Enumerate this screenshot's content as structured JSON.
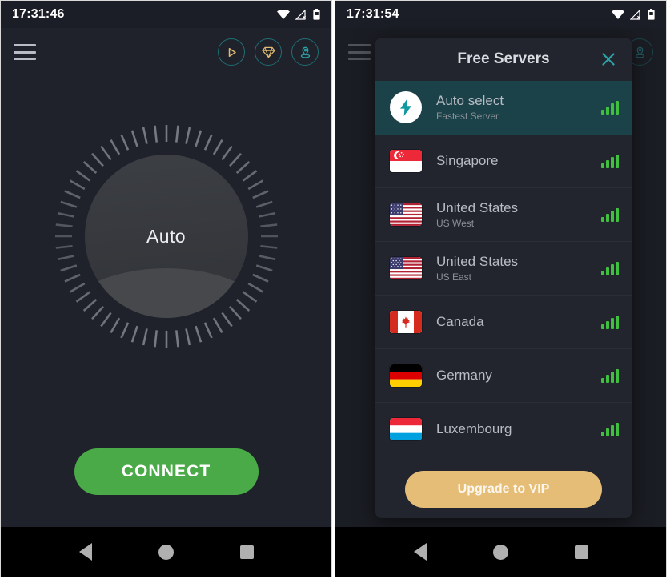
{
  "left_screen": {
    "status_bar": {
      "time": "17:31:46",
      "icons": [
        "wifi-icon",
        "cellular-off-icon",
        "battery-icon"
      ]
    },
    "app_bar": {
      "menu_icon": "hamburger-menu-icon",
      "actions": [
        {
          "name": "play-button",
          "icon": "play-icon",
          "color": "#e0b972"
        },
        {
          "name": "vip-diamond-button",
          "icon": "diamond-icon",
          "color": "#e0b972"
        },
        {
          "name": "location-button",
          "icon": "location-pin-icon",
          "color": "#2aa3a8"
        }
      ]
    },
    "dial": {
      "label": "Auto",
      "tick_count": 60
    },
    "connect_button": {
      "label": "CONNECT",
      "color": "#4aaa47"
    },
    "nav_bar": {
      "back": "back-triangle-icon",
      "home": "home-circle-icon",
      "recents": "recents-square-icon"
    }
  },
  "right_screen": {
    "status_bar": {
      "time": "17:31:54",
      "icons": [
        "wifi-icon",
        "cellular-off-icon",
        "battery-icon"
      ]
    },
    "dialog": {
      "title": "Free Servers",
      "close_icon": "close-x-icon",
      "close_color": "#2aa3a8",
      "servers": [
        {
          "name": "Auto select",
          "subtitle": "Fastest Server",
          "icon": "lightning-bolt-icon",
          "flag": "auto",
          "signal": 4,
          "selected": true
        },
        {
          "name": "Singapore",
          "subtitle": "",
          "flag": "singapore",
          "signal": 4,
          "selected": false
        },
        {
          "name": "United States",
          "subtitle": "US West",
          "flag": "usa",
          "signal": 4,
          "selected": false
        },
        {
          "name": "United States",
          "subtitle": "US East",
          "flag": "usa",
          "signal": 4,
          "selected": false
        },
        {
          "name": "Canada",
          "subtitle": "",
          "flag": "canada",
          "signal": 4,
          "selected": false
        },
        {
          "name": "Germany",
          "subtitle": "",
          "flag": "germany",
          "signal": 4,
          "selected": false
        },
        {
          "name": "Luxembourg",
          "subtitle": "",
          "flag": "luxembourg",
          "signal": 4,
          "selected": false
        }
      ],
      "upgrade_button": {
        "label": "Upgrade to VIP",
        "color": "#e5bd76"
      }
    },
    "nav_bar": {
      "back": "back-triangle-icon",
      "home": "home-circle-icon",
      "recents": "recents-square-icon"
    }
  },
  "theme": {
    "background": "#1f222b",
    "dialog_background": "#22252e",
    "selected_row": "#1b4248",
    "accent_teal": "#2aa3a8",
    "accent_gold": "#e0b972",
    "signal_green": "#3fc13f"
  }
}
